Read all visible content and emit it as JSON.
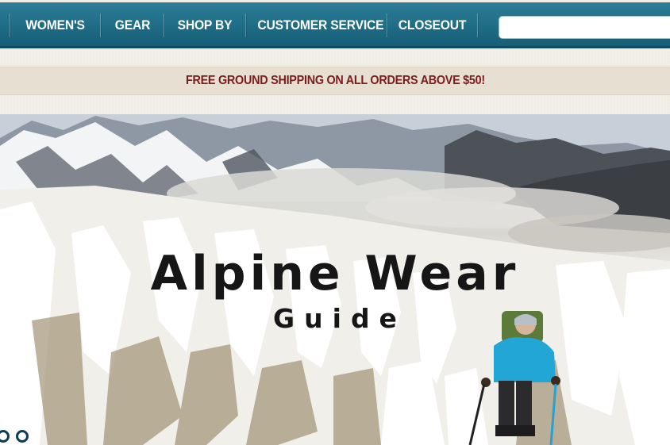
{
  "nav": {
    "items": [
      {
        "label": "WOMEN'S"
      },
      {
        "label": "GEAR"
      },
      {
        "label": "SHOP BY"
      },
      {
        "label": "CUSTOMER SERVICE"
      },
      {
        "label": "CLOSEOUT"
      }
    ],
    "search": {
      "value": "",
      "placeholder": ""
    }
  },
  "promo": {
    "text": "FREE GROUND SHIPPING ON ALL ORDERS ABOVE $50!"
  },
  "hero": {
    "title": "Alpine Wear",
    "subtitle": "Guide",
    "slide_count": 2,
    "active_slide": 1
  },
  "colors": {
    "nav_bg": "#1f6c86",
    "promo_text": "#7a1c1c",
    "promo_bg": "#e7e0d2"
  }
}
